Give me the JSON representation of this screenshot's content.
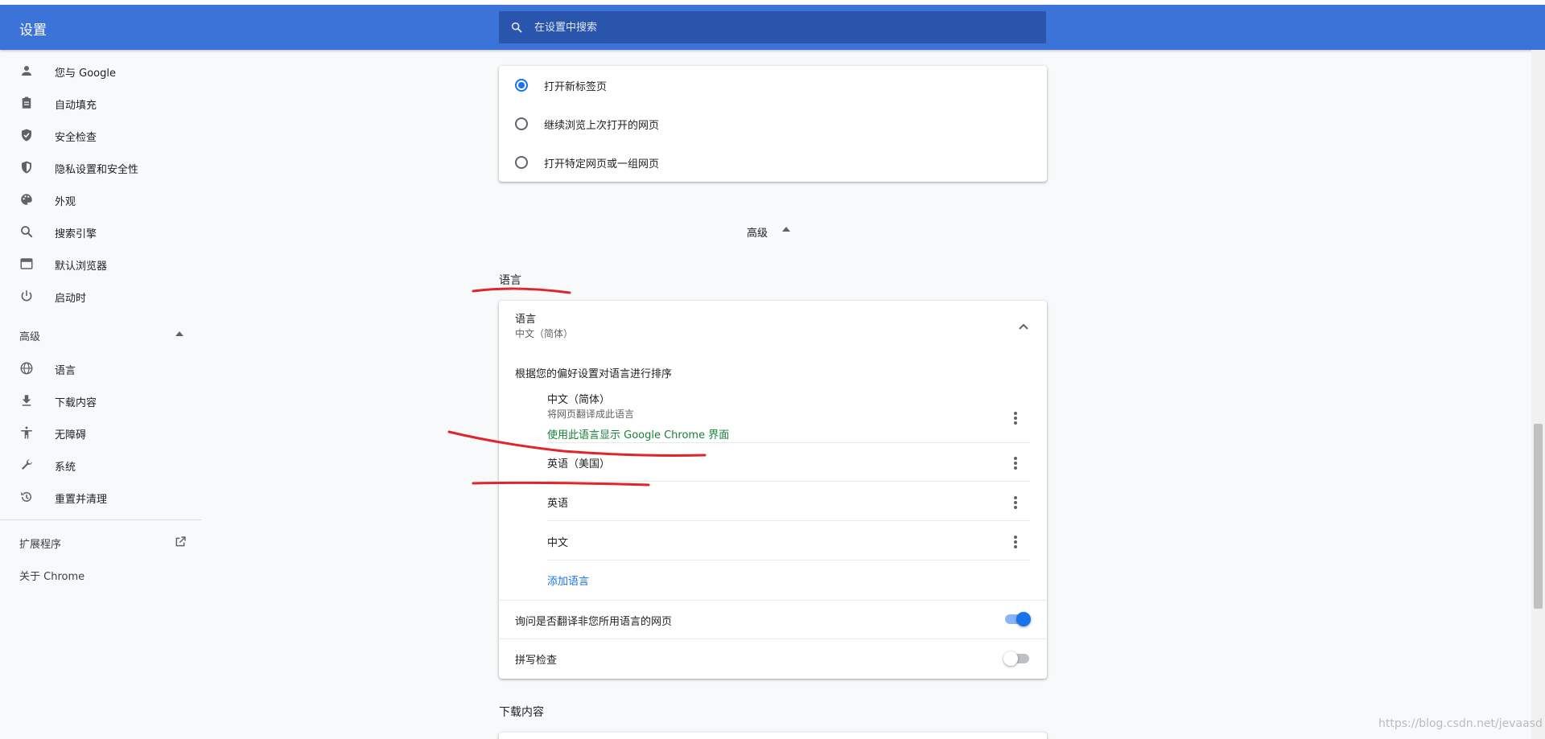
{
  "header": {
    "title": "设置",
    "search_placeholder": "在设置中搜索"
  },
  "sidebar": {
    "items": [
      {
        "label": "您与 Google",
        "icon": "person-icon"
      },
      {
        "label": "自动填充",
        "icon": "clipboard-icon"
      },
      {
        "label": "安全检查",
        "icon": "shield-check-icon"
      },
      {
        "label": "隐私设置和安全性",
        "icon": "privacy-shield-icon"
      },
      {
        "label": "外观",
        "icon": "palette-icon"
      },
      {
        "label": "搜索引擎",
        "icon": "search-icon"
      },
      {
        "label": "默认浏览器",
        "icon": "browser-window-icon"
      },
      {
        "label": "启动时",
        "icon": "power-icon"
      }
    ],
    "advanced_label": "高级",
    "advanced_items": [
      {
        "label": "语言",
        "icon": "globe-icon"
      },
      {
        "label": "下载内容",
        "icon": "download-icon"
      },
      {
        "label": "无障碍",
        "icon": "accessibility-icon"
      },
      {
        "label": "系统",
        "icon": "wrench-icon"
      },
      {
        "label": "重置并清理",
        "icon": "history-icon"
      }
    ],
    "extensions_label": "扩展程序",
    "about_label": "关于 Chrome"
  },
  "startup": {
    "options": [
      {
        "label": "打开新标签页",
        "checked": true
      },
      {
        "label": "继续浏览上次打开的网页",
        "checked": false
      },
      {
        "label": "打开特定网页或一组网页",
        "checked": false
      }
    ]
  },
  "advanced_toggle": "高级",
  "languages": {
    "section_title": "语言",
    "card_title": "语言",
    "card_subtitle": "中文（简体）",
    "order_hint": "根据您的偏好设置对语言进行排序",
    "list": [
      {
        "name": "中文（简体）",
        "note": "将网页翻译成此语言",
        "ui_note": "使用此语言显示 Google Chrome 界面"
      },
      {
        "name": "英语（美国）"
      },
      {
        "name": "英语"
      },
      {
        "name": "中文"
      }
    ],
    "add_language": "添加语言",
    "offer_translate": {
      "label": "询问是否翻译非您所用语言的网页",
      "enabled": true
    },
    "spell_check": {
      "label": "拼写检查",
      "enabled": false
    }
  },
  "downloads_section_title": "下载内容",
  "watermark": "https://blog.csdn.net/jevaasd",
  "colors": {
    "header": "#3b73d8",
    "search": "#2a55ad",
    "accent": "#1a73e8",
    "annotation": "#e0252b",
    "green": "#188038"
  }
}
